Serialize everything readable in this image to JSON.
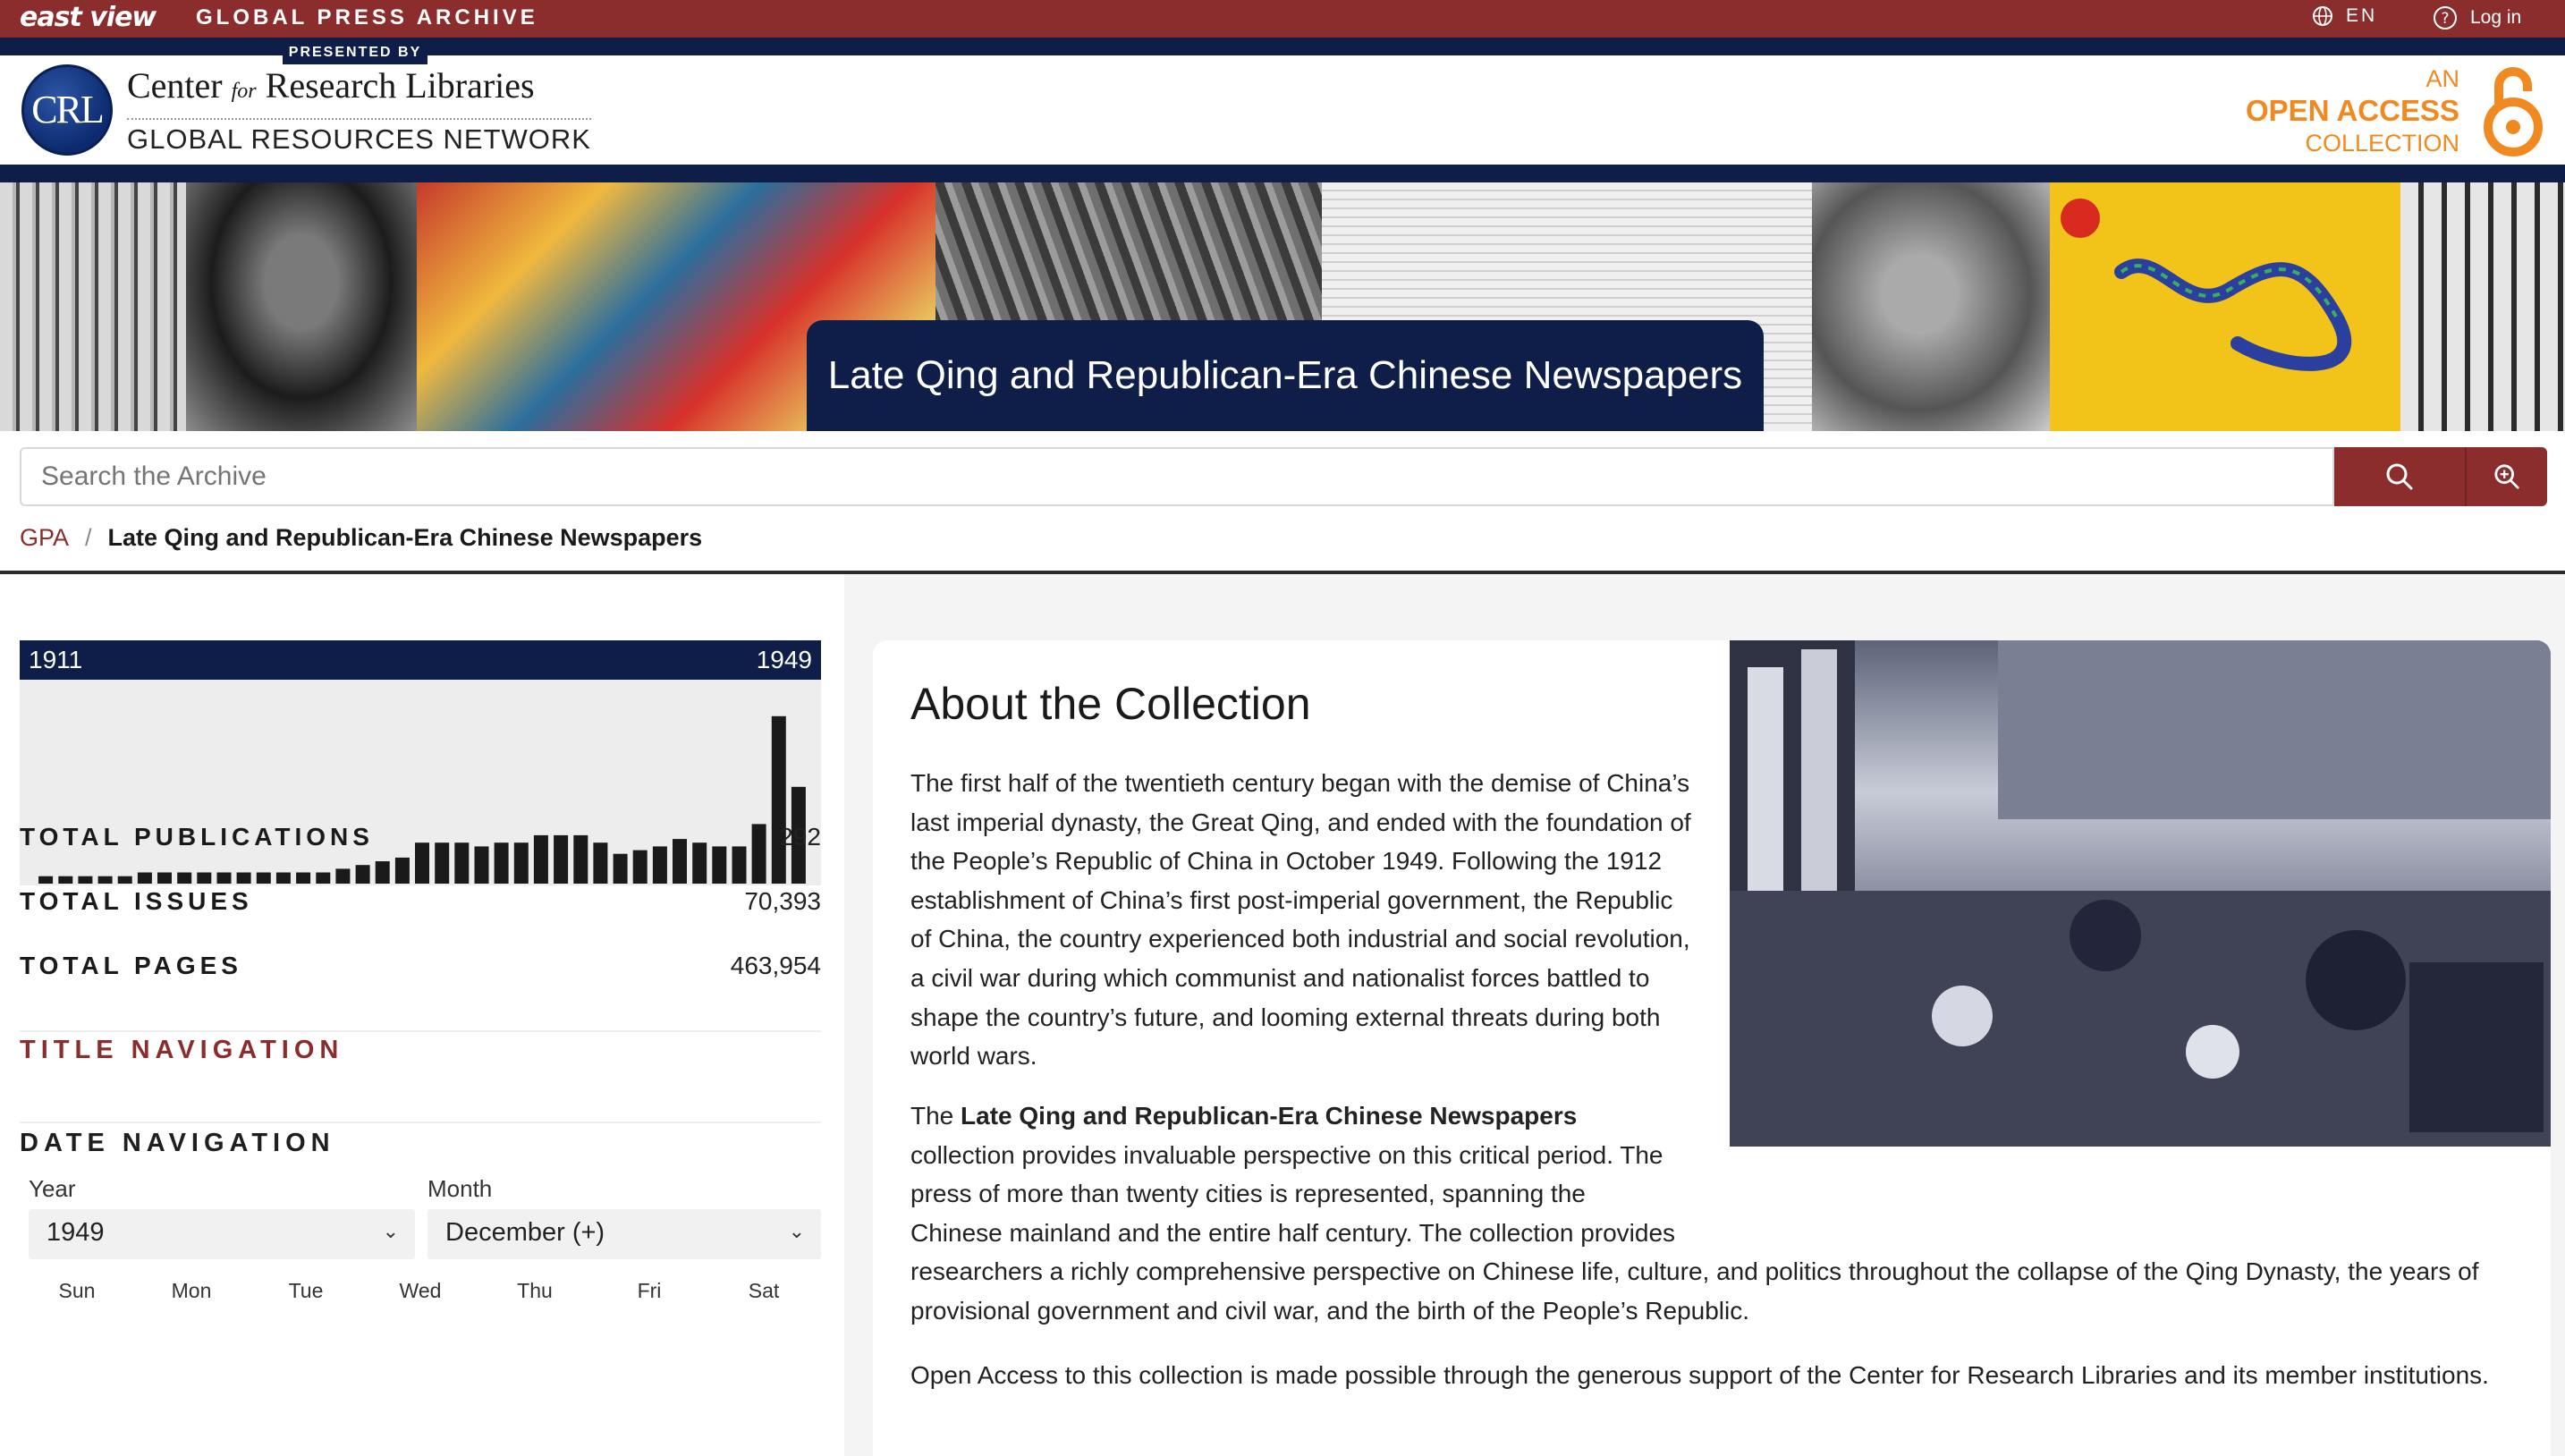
{
  "topbar": {
    "brand": "east view",
    "product": "GLOBAL PRESS ARCHIVE",
    "presented_by": "PRESENTED BY",
    "language": "EN",
    "login": "Log in"
  },
  "header": {
    "crl_seal": "CRL",
    "crl_name_pre": "Center ",
    "crl_name_for": "for",
    "crl_name_post": " Research Libraries",
    "crl_network": "GLOBAL RESOURCES NETWORK",
    "oa_an": "AN",
    "oa_main": "OPEN ACCESS",
    "oa_collection": "COLLECTION"
  },
  "banner": {
    "title": "Late Qing and Republican-Era Chinese Newspapers"
  },
  "search": {
    "placeholder": "Search the Archive"
  },
  "breadcrumb": {
    "root": "GPA",
    "separator": "/",
    "current": "Late Qing and Republican-Era Chinese Newspapers"
  },
  "sidebar": {
    "year_start": "1911",
    "year_end": "1949",
    "chart_data": {
      "type": "bar",
      "x": [
        1911,
        1912,
        1913,
        1914,
        1915,
        1916,
        1917,
        1918,
        1919,
        1920,
        1921,
        1922,
        1923,
        1924,
        1925,
        1926,
        1927,
        1928,
        1929,
        1930,
        1931,
        1932,
        1933,
        1934,
        1935,
        1936,
        1937,
        1938,
        1939,
        1940,
        1941,
        1942,
        1943,
        1944,
        1945,
        1946,
        1947,
        1948,
        1949
      ],
      "values": [
        2,
        2,
        2,
        2,
        2,
        3,
        3,
        3,
        3,
        3,
        3,
        3,
        3,
        3,
        3,
        4,
        5,
        6,
        7,
        11,
        11,
        11,
        10,
        11,
        11,
        13,
        13,
        13,
        11,
        8,
        9,
        10,
        12,
        11,
        10,
        10,
        16,
        45,
        26
      ],
      "title": "",
      "xlabel": "",
      "ylabel": "",
      "ylim": [
        0,
        50
      ],
      "color": "#1a1a1a"
    },
    "stats": [
      {
        "label": "TOTAL PUBLICATIONS",
        "value": "292"
      },
      {
        "label": "TOTAL ISSUES",
        "value": "70,393"
      },
      {
        "label": "TOTAL PAGES",
        "value": "463,954"
      }
    ],
    "title_nav": "TITLE NAVIGATION",
    "date_nav": "DATE NAVIGATION",
    "year_label": "Year",
    "year_value": "1949",
    "month_label": "Month",
    "month_value": "December (+)",
    "weekdays": [
      "Sun",
      "Mon",
      "Tue",
      "Wed",
      "Thu",
      "Fri",
      "Sat"
    ]
  },
  "about": {
    "heading": "About the Collection",
    "p1": "The first half of the twentieth century began with the demise of China’s last imperial dynasty, the Great Qing, and ended with the foundation of the People’s Republic of China in October 1949. Following the 1912 establishment of China’s first post-imperial government, the Republic of China, the country experienced both industrial and social revolution, a civil war during which communist and nationalist forces battled to shape the country’s future, and looming external threats during both world wars.",
    "p2_pre": "The ",
    "p2_bold": "Late Qing and Republican-Era Chinese Newspapers",
    "p2_post": " collection provides invaluable perspective on this critical period. The press of more than twenty cities is represented, spanning the Chinese mainland and the entire half century. The collection provides researchers a richly comprehensive perspective on Chinese life, culture, and politics throughout the collapse of the Qing Dynasty, the years of provisional government and civil war, and the birth of the People’s Republic.",
    "p3": "Open Access to this collection is made possible through the generous support of the Center for Research Libraries and its member institutions."
  },
  "colors": {
    "maroon": "#8b2d2d",
    "navy": "#0e1e49",
    "orange": "#f08a20"
  }
}
